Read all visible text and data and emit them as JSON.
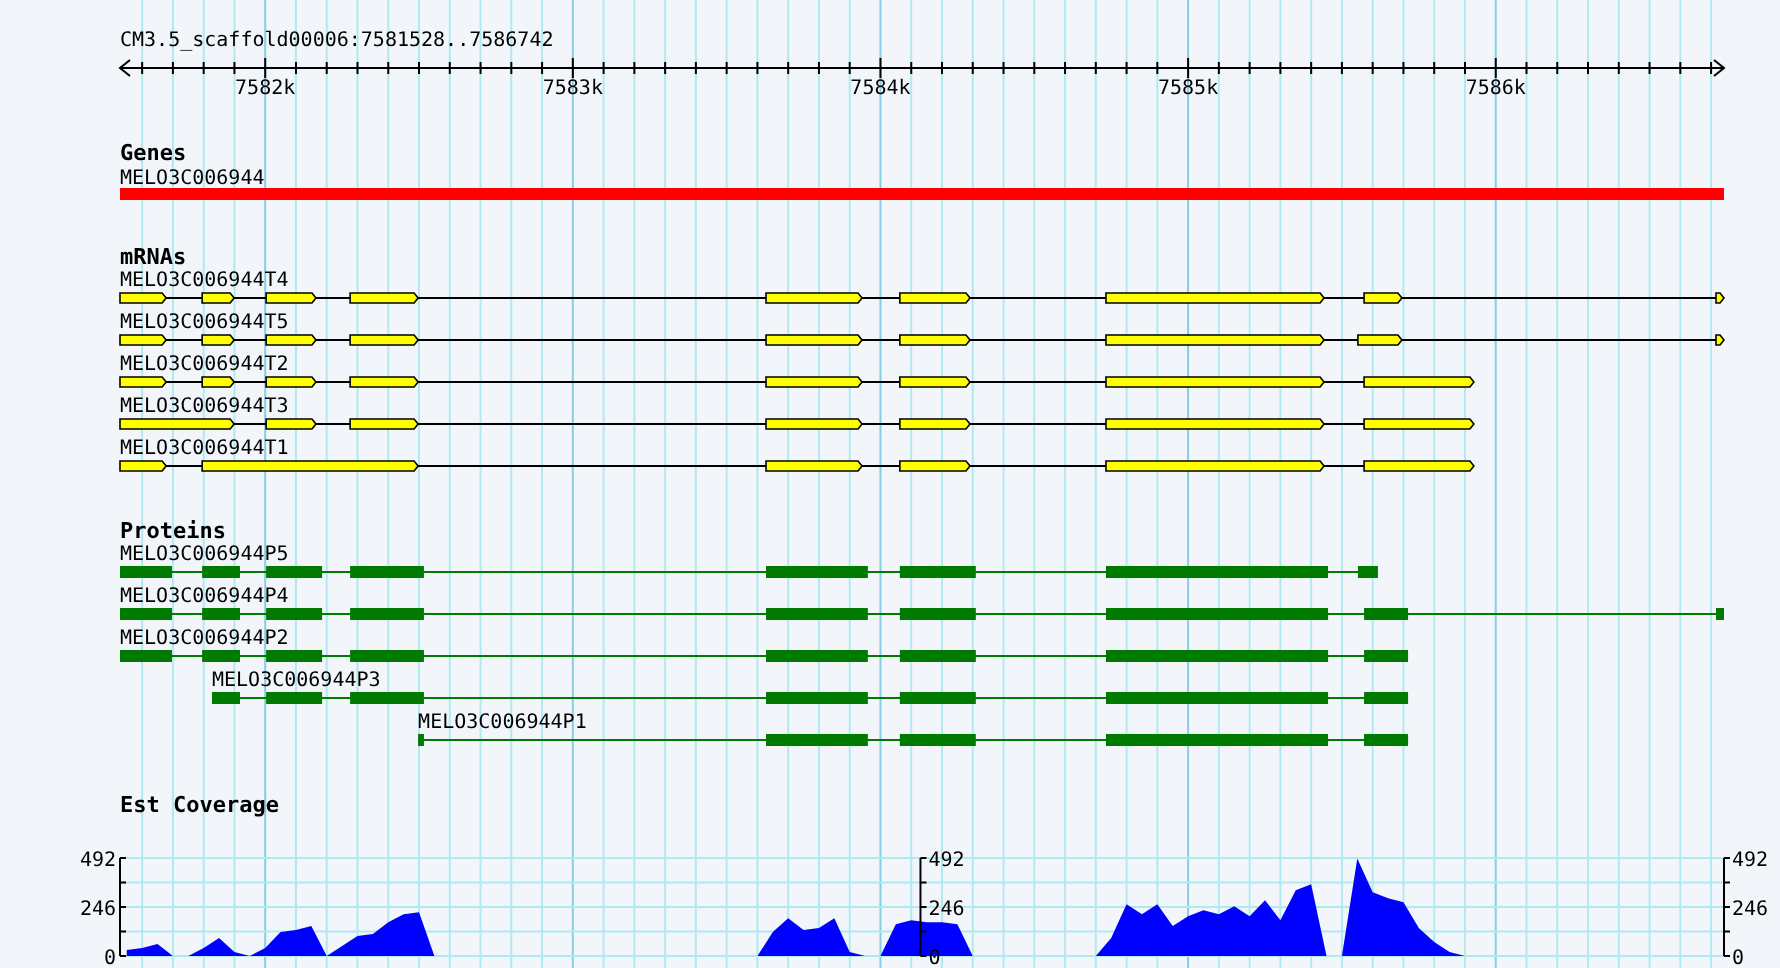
{
  "ruler": {
    "title": "CM3.5_scaffold00006:7581528..7586742",
    "labels": [
      "7582k",
      "7583k",
      "7584k",
      "7585k",
      "7586k"
    ]
  },
  "genes": {
    "title": "Genes",
    "items": [
      {
        "name": "MELO3C006944",
        "color": "#ff0000"
      }
    ]
  },
  "mrnas": {
    "title": "mRNAs",
    "items": [
      {
        "name": "MELO3C006944T4"
      },
      {
        "name": "MELO3C006944T5"
      },
      {
        "name": "MELO3C006944T2"
      },
      {
        "name": "MELO3C006944T3"
      },
      {
        "name": "MELO3C006944T1"
      }
    ]
  },
  "proteins": {
    "title": "Proteins",
    "items": [
      {
        "name": "MELO3C006944P5"
      },
      {
        "name": "MELO3C006944P4"
      },
      {
        "name": "MELO3C006944P2"
      },
      {
        "name": "MELO3C006944P3"
      },
      {
        "name": "MELO3C006944P1"
      }
    ]
  },
  "coverage": {
    "title": "Est Coverage",
    "axes": [
      {
        "kind": "left",
        "labels": [
          "492",
          "246",
          "0"
        ]
      },
      {
        "kind": "center",
        "labels": [
          "492",
          "246",
          "0"
        ]
      },
      {
        "kind": "right",
        "labels": [
          "492",
          "246",
          "0"
        ]
      }
    ]
  }
}
